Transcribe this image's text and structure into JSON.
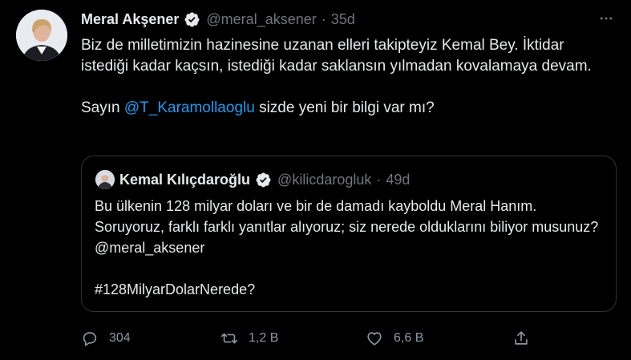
{
  "tweet": {
    "author_name": "Meral Akşener",
    "handle": "@meral_aksener",
    "separator": "·",
    "age": "35d",
    "more_icon": "ellipsis-icon",
    "lines": [
      "Biz de milletimizin hazinesine uzanan elleri takipteyiz Kemal Bey. İktidar istediği kadar kaçsın, istediği kadar saklansın yılmadan kovalamaya devam."
    ],
    "second_para_prefix": "Sayın ",
    "mention": "@T_Karamollaoglu",
    "second_para_suffix": " sizde yeni bir bilgi var mı?"
  },
  "quote": {
    "author_name": "Kemal Kılıçdaroğlu",
    "handle": "@kilicdarogluk",
    "separator": "·",
    "age": "49d",
    "para1": "Bu ülkenin 128 milyar doları ve bir de damadı kayboldu Meral Hanım. Soruyoruz, farklı farklı yanıtlar alıyoruz; siz nerede olduklarını biliyor musunuz? @meral_aksener",
    "para2": "#128MilyarDolarNerede?"
  },
  "actions": {
    "reply_count": "304",
    "retweet_count": "1,2 B",
    "like_count": "6,6 B",
    "share_count": ""
  },
  "colors": {
    "background": "#000000",
    "text": "#e7e9ea",
    "muted": "#71767b",
    "link": "#1d9bf0",
    "verified": "#1d9bf0",
    "border": "#2f3336"
  }
}
